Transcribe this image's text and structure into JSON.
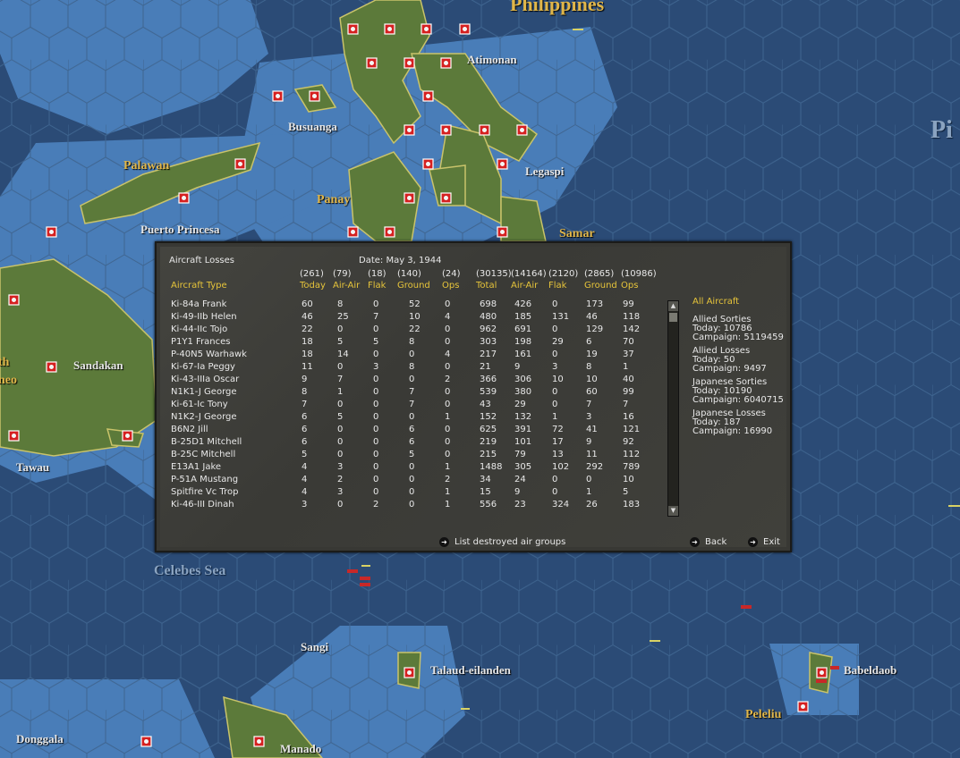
{
  "map": {
    "labels": [
      {
        "text": "Philippines",
        "cls": "big"
      },
      {
        "text": "Atimonan",
        "cls": ""
      },
      {
        "text": "Busuanga",
        "cls": ""
      },
      {
        "text": "Palawan",
        "cls": "yellow"
      },
      {
        "text": "Legaspi",
        "cls": ""
      },
      {
        "text": "Panay",
        "cls": "yellow"
      },
      {
        "text": "Puerto Princesa",
        "cls": ""
      },
      {
        "text": "Samar",
        "cls": "yellow"
      },
      {
        "text": "Sandakan",
        "cls": ""
      },
      {
        "text": "th",
        "cls": "yellow"
      },
      {
        "text": "neo",
        "cls": "yellow"
      },
      {
        "text": "Tawau",
        "cls": ""
      },
      {
        "text": "Celebes Sea",
        "cls": "sea"
      },
      {
        "text": "Sangi",
        "cls": ""
      },
      {
        "text": "Talaud-eilanden",
        "cls": ""
      },
      {
        "text": "Babeldaob",
        "cls": ""
      },
      {
        "text": "Peleliu",
        "cls": "yellow"
      },
      {
        "text": "Donggala",
        "cls": ""
      },
      {
        "text": "Manado",
        "cls": ""
      },
      {
        "text": "Pi",
        "cls": "sea"
      }
    ]
  },
  "panel": {
    "title": "Aircraft Losses",
    "date": "Date: May 3, 1944",
    "totals": [
      "(261)",
      "(79)",
      "(18)",
      "(140)",
      "(24)",
      "(30135)",
      "(14164)",
      "(2120)",
      "(2865)",
      "(10986)"
    ],
    "headers": [
      "Aircraft Type",
      "Today",
      "Air-Air",
      "Flak",
      "Ground",
      "Ops",
      "Total",
      "Air-Air",
      "Flak",
      "Ground",
      "Ops"
    ],
    "rows": [
      [
        "Ki-84a Frank",
        "60",
        "8",
        "0",
        "52",
        "0",
        "698",
        "426",
        "0",
        "173",
        "99"
      ],
      [
        "Ki-49-IIb Helen",
        "46",
        "25",
        "7",
        "10",
        "4",
        "480",
        "185",
        "131",
        "46",
        "118"
      ],
      [
        "Ki-44-IIc Tojo",
        "22",
        "0",
        "0",
        "22",
        "0",
        "962",
        "691",
        "0",
        "129",
        "142"
      ],
      [
        "P1Y1 Frances",
        "18",
        "5",
        "5",
        "8",
        "0",
        "303",
        "198",
        "29",
        "6",
        "70"
      ],
      [
        "P-40N5 Warhawk",
        "18",
        "14",
        "0",
        "0",
        "4",
        "217",
        "161",
        "0",
        "19",
        "37"
      ],
      [
        "Ki-67-Ia Peggy",
        "11",
        "0",
        "3",
        "8",
        "0",
        "21",
        "9",
        "3",
        "8",
        "1"
      ],
      [
        "Ki-43-IIIa Oscar",
        "9",
        "7",
        "0",
        "0",
        "2",
        "366",
        "306",
        "10",
        "10",
        "40"
      ],
      [
        "N1K1-J George",
        "8",
        "1",
        "0",
        "7",
        "0",
        "539",
        "380",
        "0",
        "60",
        "99"
      ],
      [
        "Ki-61-Ic Tony",
        "7",
        "0",
        "0",
        "7",
        "0",
        "43",
        "29",
        "0",
        "7",
        "7"
      ],
      [
        "N1K2-J George",
        "6",
        "5",
        "0",
        "0",
        "1",
        "152",
        "132",
        "1",
        "3",
        "16"
      ],
      [
        "B6N2 Jill",
        "6",
        "0",
        "0",
        "6",
        "0",
        "625",
        "391",
        "72",
        "41",
        "121"
      ],
      [
        "B-25D1 Mitchell",
        "6",
        "0",
        "0",
        "6",
        "0",
        "219",
        "101",
        "17",
        "9",
        "92"
      ],
      [
        "B-25C Mitchell",
        "5",
        "0",
        "0",
        "5",
        "0",
        "215",
        "79",
        "13",
        "11",
        "112"
      ],
      [
        "E13A1 Jake",
        "4",
        "3",
        "0",
        "0",
        "1",
        "1488",
        "305",
        "102",
        "292",
        "789"
      ],
      [
        "P-51A Mustang",
        "4",
        "2",
        "0",
        "0",
        "2",
        "34",
        "24",
        "0",
        "0",
        "10"
      ],
      [
        "Spitfire Vc Trop",
        "4",
        "3",
        "0",
        "0",
        "1",
        "15",
        "9",
        "0",
        "1",
        "5"
      ],
      [
        "Ki-46-III Dinah",
        "3",
        "0",
        "2",
        "0",
        "1",
        "556",
        "23",
        "324",
        "26",
        "183"
      ]
    ],
    "side": {
      "filter": "All Aircraft",
      "allied_sorties": {
        "title": "Allied Sorties",
        "today": "Today:   10786",
        "campaign": "Campaign: 5119459"
      },
      "allied_losses": {
        "title": "Allied Losses",
        "today": "Today:   50",
        "campaign": "Campaign: 9497"
      },
      "japanese_sorties": {
        "title": "Japanese Sorties",
        "today": "Today:   10190",
        "campaign": "Campaign: 6040715"
      },
      "japanese_losses": {
        "title": "Japanese Losses",
        "today": "Today:   187",
        "campaign": "Campaign: 16990"
      }
    },
    "buttons": {
      "list": "List destroyed air groups",
      "back": "Back",
      "exit": "Exit"
    }
  }
}
